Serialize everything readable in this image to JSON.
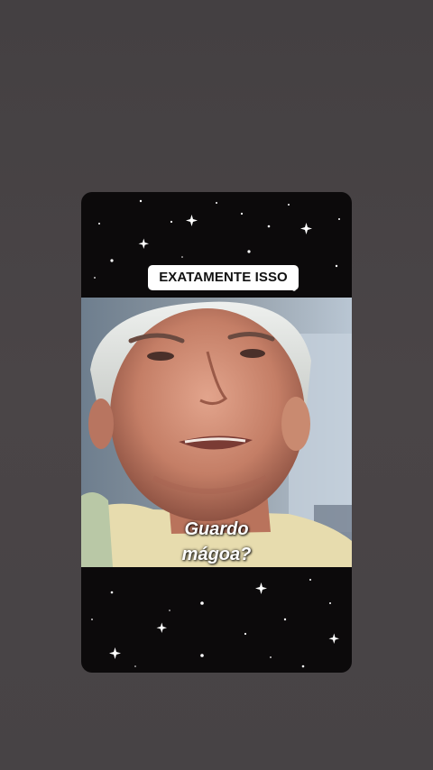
{
  "reel": {
    "title_badge": "EXATAMENTE ISSO",
    "subtitle_line1": "Guardo",
    "subtitle_line2": "mágoa?"
  },
  "colors": {
    "page_background": "#474345",
    "card_background": "#0c0a0b",
    "badge_background": "#ffffff",
    "caption_text": "#ffffff"
  }
}
